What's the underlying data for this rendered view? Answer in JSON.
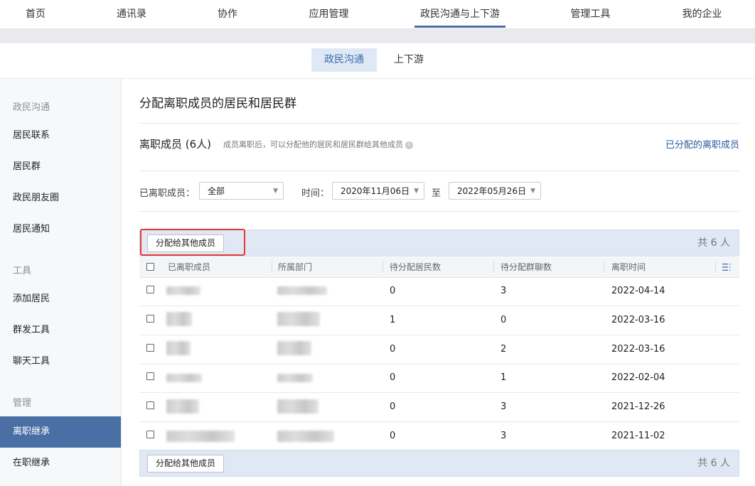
{
  "topnav": {
    "items": [
      "首页",
      "通讯录",
      "协作",
      "应用管理",
      "政民沟通与上下游",
      "管理工具",
      "我的企业"
    ],
    "active_index": 4
  },
  "subnav": {
    "tabs": [
      "政民沟通",
      "上下游"
    ],
    "active_index": 0
  },
  "sidebar": {
    "sections": [
      {
        "title": "政民沟通",
        "items": [
          "居民联系",
          "居民群",
          "政民朋友圈",
          "居民通知"
        ]
      },
      {
        "title": "工具",
        "items": [
          "添加居民",
          "群发工具",
          "聊天工具"
        ]
      },
      {
        "title": "管理",
        "items": [
          "离职继承",
          "在职继承"
        ]
      }
    ],
    "active_item": "离职继承"
  },
  "main": {
    "title": "分配离职成员的居民和居民群",
    "section_title": "离职成员 (6人)",
    "section_hint": "成员离职后，可以分配他的居民和居民群给其他成员",
    "assigned_link": "已分配的离职成员",
    "filters": {
      "member_label": "已离职成员：",
      "member_value": "全部",
      "time_label": "时间：",
      "start_date": "2020年11月06日",
      "to_label": "至",
      "end_date": "2022年05月26日"
    },
    "assign_button": "分配给其他成员",
    "total": "共 6 人",
    "columns": [
      "已离职成员",
      "所属部门",
      "待分配居民数",
      "待分配群聊数",
      "离职时间"
    ],
    "rows": [
      {
        "residents": "0",
        "groups": "3",
        "date": "2022-04-14"
      },
      {
        "residents": "1",
        "groups": "0",
        "date": "2022-03-16"
      },
      {
        "residents": "0",
        "groups": "2",
        "date": "2022-03-16"
      },
      {
        "residents": "0",
        "groups": "1",
        "date": "2022-02-04"
      },
      {
        "residents": "0",
        "groups": "3",
        "date": "2021-12-26"
      },
      {
        "residents": "0",
        "groups": "3",
        "date": "2021-11-02"
      }
    ]
  },
  "colors": {
    "accent": "#4a6fa5",
    "highlight_border": "#e53935",
    "toolbar_bg": "#dfe8f4"
  }
}
